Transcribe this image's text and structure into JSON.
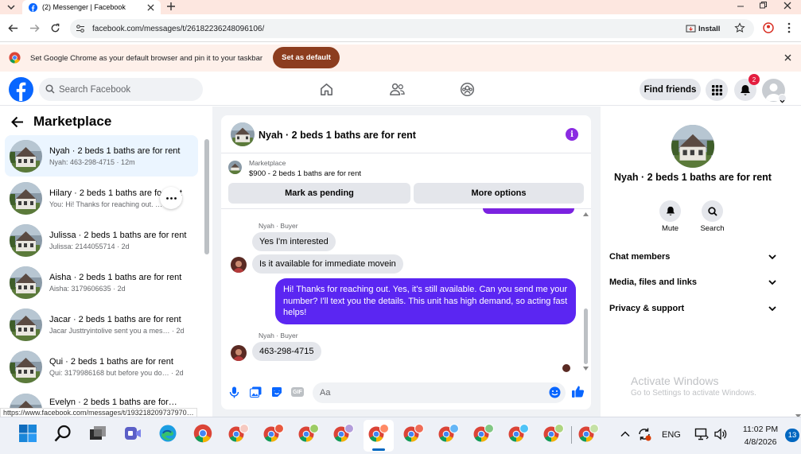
{
  "browser": {
    "tab_title": "(2) Messenger | Facebook",
    "url": "facebook.com/messages/t/26182236248096106/",
    "install_label": "Install",
    "infobar_text": "Set Google Chrome as your default browser and pin it to your taskbar",
    "set_default_label": "Set as default",
    "status_url": "https://www.facebook.com/messages/t/193218209737970…"
  },
  "header": {
    "search_placeholder": "Search Facebook",
    "find_friends_label": "Find friends",
    "notification_count": "2"
  },
  "sidebar": {
    "title": "Marketplace",
    "conversations": [
      {
        "title": "Nyah · 2 beds 1 baths are for rent",
        "subtitle": "Nyah: 463-298-4715 · 12m"
      },
      {
        "title": "Hilary · 2 beds 1 baths are for rent",
        "subtitle": "You: Hi! Thanks for reaching out. … · 1m"
      },
      {
        "title": "Julissa · 2 beds 1 baths are for rent",
        "subtitle": "Julissa: 2144055714 · 2d"
      },
      {
        "title": "Aisha · 2 beds 1 baths are for rent",
        "subtitle": "Aisha: 3179606635 · 2d"
      },
      {
        "title": "Jacar · 2 beds 1 baths are for rent",
        "subtitle": "Jacar Justtryintolive sent you a mes… · 2d"
      },
      {
        "title": "Qui · 2 beds 1 baths are for rent",
        "subtitle": "Qui: 3179986168 but before you do… · 2d"
      },
      {
        "title": "Evelyn · 2 beds 1 baths are for…",
        "subtitle": ""
      }
    ]
  },
  "chat": {
    "title": "Nyah · 2 beds 1 baths are for rent",
    "marketplace_label": "Marketplace",
    "listing": "$900 - 2 beds 1 baths are for rent",
    "mark_pending_label": "Mark as pending",
    "more_options_label": "More options",
    "messages": [
      {
        "sender": "Nyah · Buyer",
        "text": "Yes I'm interested"
      },
      {
        "sender": "",
        "text": "Is it available for immediate movein"
      },
      {
        "sender": "You",
        "text": "Hi! Thanks for reaching out. Yes, it's still available. Can you send me your number? I'll text you the details. This unit has high demand, so acting fast helps!"
      },
      {
        "sender": "Nyah · Buyer",
        "text": "463-298-4715"
      }
    ],
    "composer_placeholder": "Aa"
  },
  "details": {
    "title": "Nyah · 2 beds 1 baths are for rent",
    "mute_label": "Mute",
    "search_label": "Search",
    "sections": [
      "Chat members",
      "Media, files and links",
      "Privacy & support"
    ]
  },
  "watermark": {
    "line1": "Activate Windows",
    "line2": "Go to Settings to activate Windows."
  },
  "taskbar": {
    "language": "ENG",
    "time": "11:02 PM",
    "date": "4/8/2026",
    "notifications": "13"
  },
  "colors": {
    "fb_blue": "#0866ff",
    "messenger_purple": "#5b26f2",
    "info_purple": "#8a2be2"
  }
}
